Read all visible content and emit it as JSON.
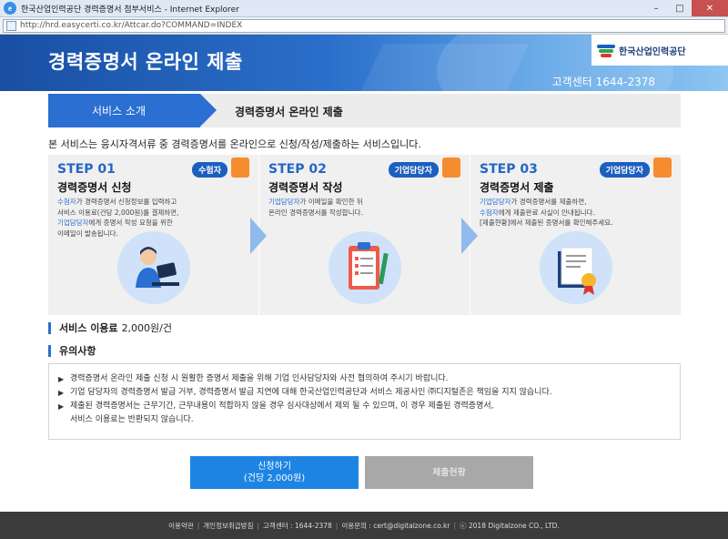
{
  "window": {
    "title": "한국산업인력공단 경력증명서 첨부서비스 - Internet Explorer",
    "url": "http://hrd.easycerti.co.kr/Attcar.do?COMMAND=INDEX",
    "minimize": "–",
    "maximize": "□",
    "close": "✕"
  },
  "header": {
    "title": "경력증명서 온라인 제출",
    "logo_text": "한국산업인력공단",
    "customer_center": "고객센터 1644-2378"
  },
  "tabs": {
    "active": "서비스 소개",
    "current": "경력증명서 온라인 제출"
  },
  "intro": "본 서비스는 응시자격서류 중 경력증명서를 온라인으로 신청/작성/제출하는 서비스입니다.",
  "steps": [
    {
      "no": "STEP 01",
      "badge": "수험자",
      "title": "경력증명서 신청",
      "lines": [
        {
          "hl": "수험자",
          "text": "가 경력증명서 신청정보를 입력하고"
        },
        {
          "hl": "",
          "text": "서비스 이용료(건당 2,000원)를 결제하면,"
        },
        {
          "hl": "기업담당자",
          "text": "에게 증명서 작성 요청을 위한"
        },
        {
          "hl": "",
          "text": "이메일이 발송됩니다."
        }
      ]
    },
    {
      "no": "STEP 02",
      "badge": "기업담당자",
      "title": "경력증명서 작성",
      "lines": [
        {
          "hl": "기업담당자",
          "text": "가 이메일을 확인한 뒤"
        },
        {
          "hl": "",
          "text": "온라인 경력증명서를 작성합니다."
        }
      ]
    },
    {
      "no": "STEP 03",
      "badge": "기업담당자",
      "title": "경력증명서 제출",
      "lines": [
        {
          "hl": "기업담당자",
          "text": "가 경력증명서를 제출하면,"
        },
        {
          "hl": "수험자",
          "text": "에게 제출완료 사실이 안내됩니다."
        },
        {
          "hl": "",
          "text": "[제출현황]에서 제출된 증명서를 확인해주세요."
        }
      ]
    }
  ],
  "fee": {
    "label": "서비스 이용료",
    "value": "2,000원/건"
  },
  "notes": {
    "label": "유의사항",
    "bullet": "▶",
    "items": [
      "경력증명서 온라인 제출 신청 시 원활한 증명서 제출을 위해 기업 인사담당자와 사전 협의하여 주시기 바랍니다.",
      "기업 담당자의 경력증명서 발급 거부, 경력증명서 발급 지연에 대해 한국산업인력공단과 서비스 제공사인 ㈜디지털존은 책임을 지지 않습니다.",
      "제출된 경력증명서는 근무기간, 근무내용이 적합하지 않을 경우 심사대상에서 제외 될 수 있으며, 이 경우 제출된 경력증명서,"
    ],
    "continuation": "서비스 이용료는 반환되지 않습니다."
  },
  "buttons": {
    "apply_line1": "신청하기",
    "apply_line2": "(건당 2,000원)",
    "status": "제출현황"
  },
  "footer": {
    "items": [
      "이용약관",
      "개인정보취급방침",
      "고객센터 : 1644-2378",
      "이용문의 : cert@digitalzone.co.kr",
      "ⓒ 2018 Digitalzone CO., LTD."
    ]
  },
  "colors": {
    "primary": "#2a6fd1",
    "badge": "#1d5fbf",
    "apply_button": "#1d84e3",
    "status_button": "#a8a8a8",
    "footer_bg": "#3b3b3b",
    "accent_orange": "#f58c2e"
  }
}
